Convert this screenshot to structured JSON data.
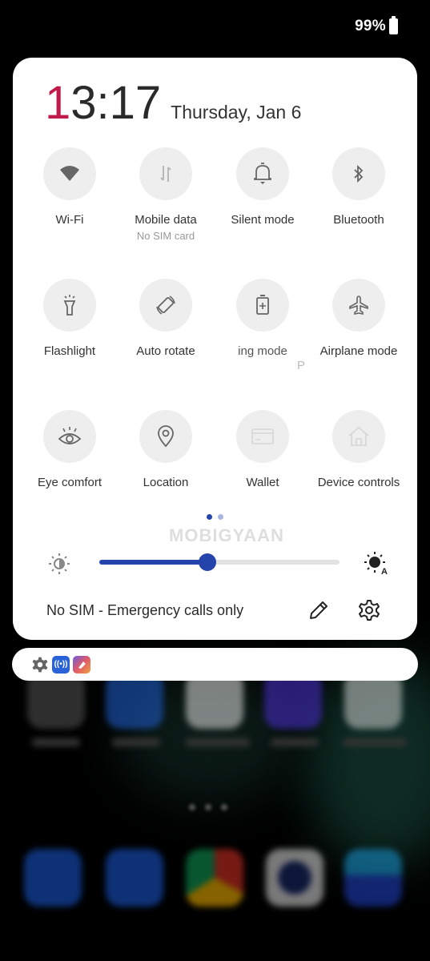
{
  "status_bar": {
    "battery_percent": "99%",
    "battery_icon": "battery-full-icon"
  },
  "header": {
    "time_first_digit": "1",
    "time_rest": "3:17",
    "date": "Thursday, Jan 6"
  },
  "tiles": [
    {
      "label": "Wi-Fi",
      "sublabel": "",
      "icon": "wifi-icon",
      "enabled": true
    },
    {
      "label": "Mobile data",
      "sublabel": "No SIM card",
      "icon": "mobile-data-icon",
      "enabled": false
    },
    {
      "label": "Silent mode",
      "sublabel": "",
      "icon": "bell-icon",
      "enabled": true
    },
    {
      "label": "Bluetooth",
      "sublabel": "",
      "icon": "bluetooth-icon",
      "enabled": true
    },
    {
      "label": "Flashlight",
      "sublabel": "",
      "icon": "flashlight-icon",
      "enabled": true
    },
    {
      "label": "Auto rotate",
      "sublabel": "",
      "icon": "auto-rotate-icon",
      "enabled": true
    },
    {
      "label": "ing mode",
      "sublabel": "",
      "icon": "battery-saver-icon",
      "enabled": true,
      "overflow_text": "P"
    },
    {
      "label": "Airplane mode",
      "sublabel": "",
      "icon": "airplane-icon",
      "enabled": true
    },
    {
      "label": "Eye comfort",
      "sublabel": "",
      "icon": "eye-icon",
      "enabled": true
    },
    {
      "label": "Location",
      "sublabel": "",
      "icon": "location-pin-icon",
      "enabled": true
    },
    {
      "label": "Wallet",
      "sublabel": "",
      "icon": "wallet-icon",
      "enabled": false
    },
    {
      "label": "Device controls",
      "sublabel": "",
      "icon": "home-icon",
      "enabled": false
    }
  ],
  "pagination": {
    "current_page": 1,
    "total_pages": 2
  },
  "brightness": {
    "level_percent": 45,
    "low_icon": "brightness-low-icon",
    "auto_icon": "brightness-auto-icon"
  },
  "footer": {
    "sim_status": "No SIM - Emergency calls only",
    "edit_icon": "pencil-icon",
    "settings_icon": "gear-icon"
  },
  "watermark": "MOBIGYAAN",
  "notification_bar": {
    "icons": [
      "gear-icon",
      "hotspot-icon",
      "app-icon"
    ],
    "hotspot_glyph": "((•))"
  },
  "colors": {
    "accent": "#2444ab",
    "clock_highlight": "#c01a4a",
    "tile_bg": "#eeeeee"
  }
}
